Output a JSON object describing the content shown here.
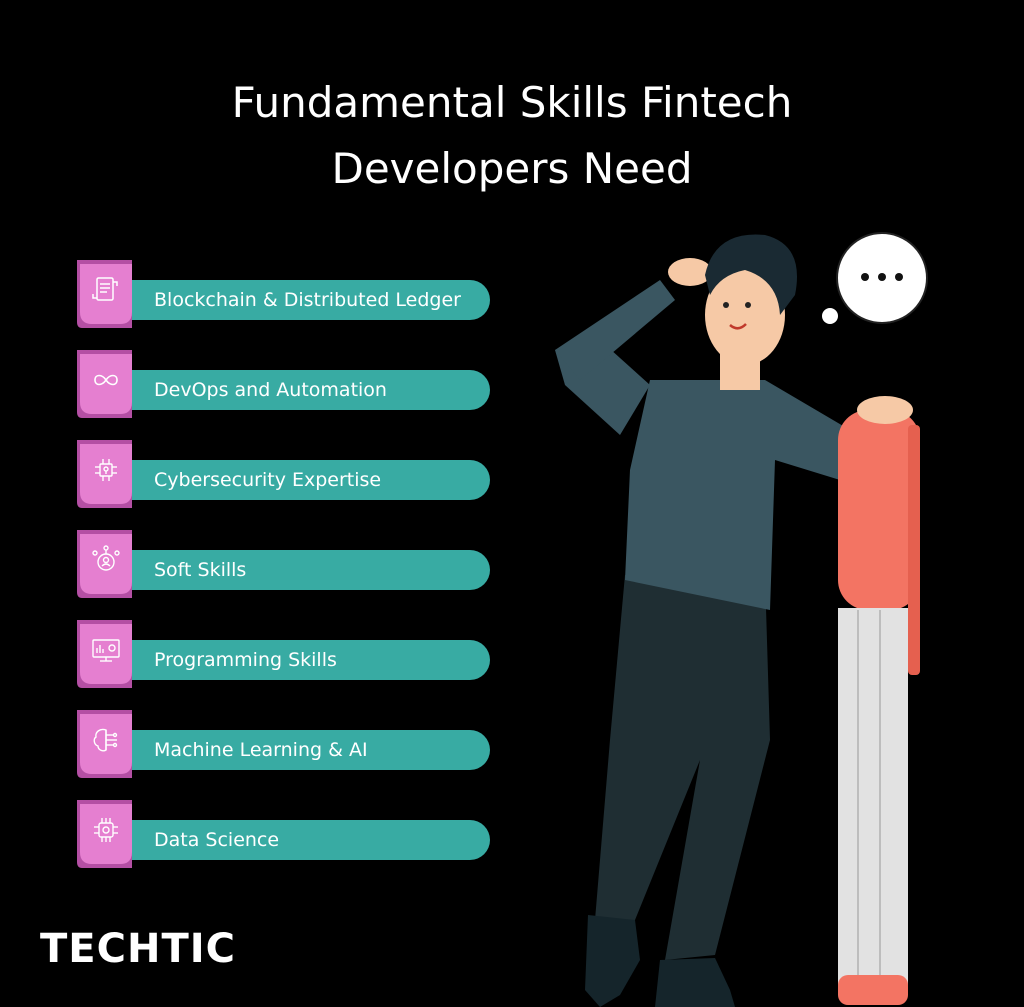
{
  "title": {
    "line1": "Fundamental Skills Fintech",
    "line2": "Developers Need"
  },
  "skills": [
    {
      "label": "Blockchain & Distributed Ledger",
      "icon": "blockchain-document-icon"
    },
    {
      "label": "DevOps and Automation",
      "icon": "infinity-loop-icon"
    },
    {
      "label": "Cybersecurity Expertise",
      "icon": "security-chip-icon"
    },
    {
      "label": "Soft Skills",
      "icon": "people-network-icon"
    },
    {
      "label": "Programming Skills",
      "icon": "monitor-code-icon"
    },
    {
      "label": "Machine Learning & AI",
      "icon": "brain-circuit-icon"
    },
    {
      "label": "Data Science",
      "icon": "data-chip-icon"
    }
  ],
  "brand": {
    "name": "TECHTIC"
  },
  "colors": {
    "background": "#000000",
    "bar": "#38aba3",
    "tab_pink": "#e57fd0",
    "tab_dark": "#b44fa4",
    "marker_red": "#f37463"
  },
  "illustration": {
    "subject": "man-thinking-leaning-on-marker-icon",
    "thought_bubble": "..."
  }
}
